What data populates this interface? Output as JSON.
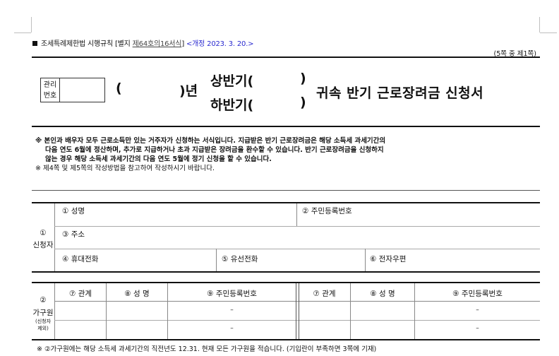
{
  "header": {
    "law": "조세특례제한법 시행규칙 [별지",
    "form_no": "제64호의16서식",
    "close": "]",
    "revision": "<개정 2023. 3. 20.>",
    "page": "(5쪽 중 제1쪽)"
  },
  "management_no_label_1": "관리",
  "management_no_label_2": "번호",
  "title": {
    "paren_open": "(",
    "year_suffix": ")년",
    "first_half": "상반기(",
    "second_half": "하반기(",
    "close1": ")",
    "close2": ")",
    "main": "귀속 반기 근로장려금 신청서"
  },
  "notes": {
    "line1": "※ 본인과 배우자 모두 근로소득만 있는 거주자가 신청하는 서식입니다. 지급받은 반기 근로장려금은 해당 소득세 과세기간의",
    "line2": "다음 연도 6월에 정산하며, 추가로 지급하거나 초과 지급받은 장려금을 환수할 수 있습니다. 반기 근로장려금을 신청하지",
    "line3": "않는 경우 해당 소득세 과세기간의 다음 연도 5월에 정기 신청을 할 수 있습니다.",
    "line4": "※ 제4쪽 및 제5쪽의 작성방법을 참고하여 작성하시기 바랍니다."
  },
  "applicant": {
    "section_no": "①",
    "section_label": "신청자",
    "name": "① 성명",
    "rrn": "② 주민등록번호",
    "address": "③ 주소",
    "mobile": "④ 휴대전화",
    "phone": "⑤ 유선전화",
    "email": "⑥ 전자우편"
  },
  "household": {
    "section_no": "②",
    "section_label": "가구원",
    "sub1": "(신청자",
    "sub2": "제외)",
    "col_relation": "⑦ 관계",
    "col_name": "⑧ 성 명",
    "col_rrn": "⑨ 주민등록번호",
    "dash": "–"
  },
  "footnote": "※ ②가구원에는 해당 소득세 과세기간의 직전년도 12.31. 현재 모든 가구원을 적습니다. (기입란이 부족하면 3쪽에 기재)"
}
